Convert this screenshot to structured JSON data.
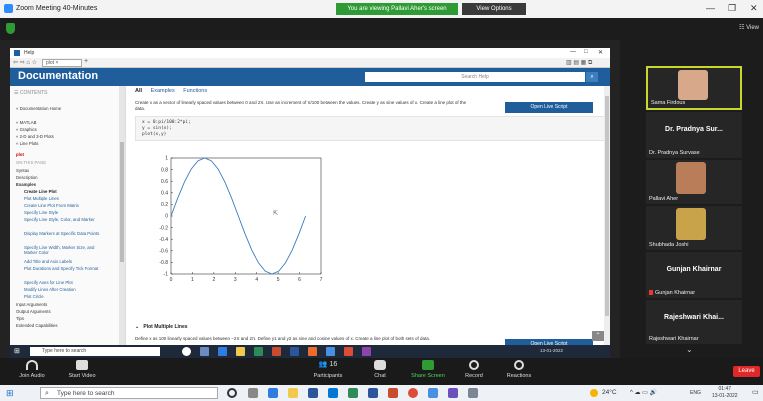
{
  "zoom": {
    "window_title": "Zoom Meeting 40-Minutes",
    "viewing_banner": "You are viewing Pallavi Aher's screen",
    "view_options": "View Options",
    "view_label": "View"
  },
  "help": {
    "window_title": "Help",
    "tab_label": "plot",
    "doc_title": "Documentation",
    "search_placeholder": "Search Help",
    "contents_label": "CONTENTS",
    "nav": [
      "« Documentation Home",
      "« MATLAB",
      "« Graphics",
      "« 2-D and 3-D Plots",
      "« Line Plots"
    ],
    "current": "plot",
    "on_this_page": "ON THIS PAGE",
    "sections": [
      "Syntax",
      "Description",
      "Examples"
    ],
    "examples": [
      "Create Line Plot",
      "Plot Multiple Lines",
      "Create Line Plot From Matrix",
      "Specify Line Style",
      "Specify Line Style, Color, and Marker",
      "Display Markers at Specific Data Points",
      "Specify Line Width, Marker Size, and Marker Color",
      "Add Title and Axis Labels",
      "Plot Durations and Specify Tick Format",
      "Specify Axes for Line Plot",
      "Modify Lines After Creation",
      "Plot Circle"
    ],
    "tail_sections": [
      "Input Arguments",
      "Output Arguments",
      "Tips",
      "Extended Capabilities"
    ],
    "tabs": [
      "All",
      "Examples",
      "Functions"
    ],
    "desc1": "Create x as a vector of linearly spaced values between 0 and 2π. Use an increment of π/100 between the values. Create y as sine values of x. Create a line plot of the data.",
    "open_live": "Open Live Script",
    "code": [
      "x = 0:pi/100:2*pi;",
      "y = sin(x);",
      "plot(x,y)"
    ],
    "plot_multi": "Plot Multiple Lines",
    "desc2": "Define x as 100 linearly spaced values between −2π and 2π. Define y1 and y2 as sine and cosine values of x. Create a line plot of both sets of data."
  },
  "chart_data": {
    "type": "line",
    "xlim": [
      0,
      7
    ],
    "ylim": [
      -1,
      1
    ],
    "xticks": [
      0,
      1,
      2,
      3,
      4,
      5,
      6,
      7
    ],
    "yticks": [
      -1,
      -0.8,
      -0.6,
      -0.4,
      -0.2,
      0,
      0.2,
      0.4,
      0.6,
      0.8,
      1
    ],
    "series": [
      {
        "function": "y = sin(x)",
        "x": [
          0,
          0.314,
          0.628,
          0.942,
          1.257,
          1.571,
          1.885,
          2.199,
          2.513,
          2.827,
          3.142,
          3.456,
          3.77,
          4.084,
          4.398,
          4.712,
          5.027,
          5.341,
          5.655,
          5.969,
          6.283
        ],
        "y": [
          0,
          0.309,
          0.588,
          0.809,
          0.951,
          1,
          0.951,
          0.809,
          0.588,
          0.309,
          0,
          -0.309,
          -0.588,
          -0.809,
          -0.951,
          -1,
          -0.951,
          -0.809,
          -0.588,
          -0.309,
          0
        ]
      }
    ],
    "grid": false,
    "color": "#3b7bbf"
  },
  "shared_taskbar": {
    "search": "Type here to search",
    "clock": "13-01-2022"
  },
  "participants": [
    {
      "name": "Sama Firdous",
      "type": "video",
      "active": true
    },
    {
      "name": "Dr. Pradnya Sur...",
      "sub": "Dr. Pradnya Survase",
      "type": "name"
    },
    {
      "name": "Pallavi Aher",
      "type": "video"
    },
    {
      "name": "Shubhada Joshi",
      "type": "video"
    },
    {
      "name": "Gunjan Khairnar",
      "sub": "Gunjan Khairnar",
      "type": "name",
      "muted": true
    },
    {
      "name": "Rajeshwari Khai...",
      "sub": "Rajeshwari Khairnar",
      "type": "name"
    }
  ],
  "controls": {
    "join_audio": "Join Audio",
    "start_video": "Start Video",
    "participants": "Participants",
    "participants_count": "16",
    "chat": "Chat",
    "share_screen": "Share Screen",
    "record": "Record",
    "reactions": "Reactions",
    "leave": "Leave"
  },
  "windows_taskbar": {
    "search": "Type here to search",
    "temperature": "24°C",
    "lang": "ENG",
    "time": "01:47",
    "date": "13-01-2022"
  },
  "colors": {
    "zoom_green": "#2e9b35",
    "doc_blue": "#1f5d9b",
    "leave_red": "#e02828",
    "active_tile": "#c8d62e"
  }
}
